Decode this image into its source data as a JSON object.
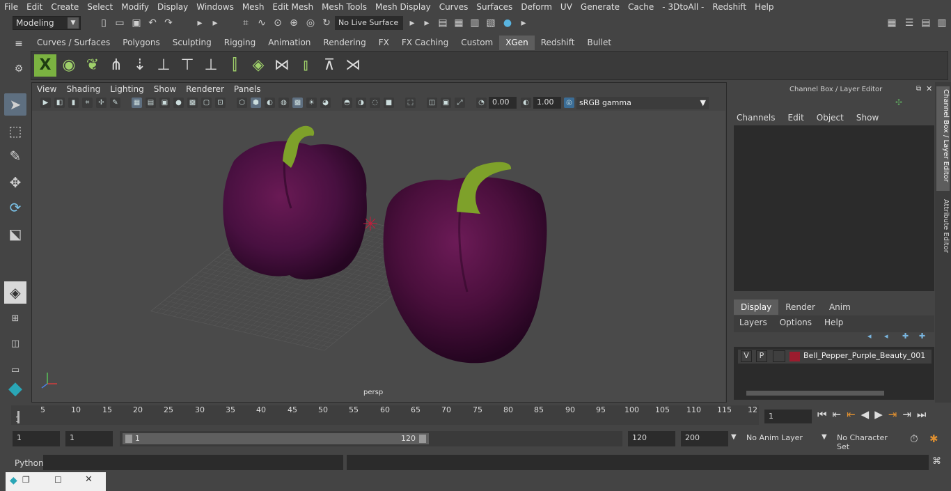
{
  "menubar": {
    "items": [
      "File",
      "Edit",
      "Create",
      "Select",
      "Modify",
      "Display",
      "Windows",
      "Mesh",
      "Edit Mesh",
      "Mesh Tools",
      "Mesh Display",
      "Curves",
      "Surfaces",
      "Deform",
      "UV",
      "Generate",
      "Cache",
      "- 3DtoAll -",
      "Redshift",
      "Help"
    ]
  },
  "status": {
    "mode": "Modeling",
    "live_surface": "No Live Surface"
  },
  "shelf": {
    "tabs": [
      "Curves / Surfaces",
      "Polygons",
      "Sculpting",
      "Rigging",
      "Animation",
      "Rendering",
      "FX",
      "FX Caching",
      "Custom",
      "XGen",
      "Redshift",
      "Bullet"
    ],
    "active_tab": "XGen"
  },
  "viewport": {
    "menus": [
      "View",
      "Shading",
      "Lighting",
      "Show",
      "Renderer",
      "Panels"
    ],
    "exposure": "0.00",
    "gamma_value": "1.00",
    "color_space": "sRGB gamma",
    "camera_label": "persp"
  },
  "channel_box": {
    "title": "Channel Box / Layer Editor",
    "menus": [
      "Channels",
      "Edit",
      "Object",
      "Show"
    ],
    "layer_tabs": [
      "Display",
      "Render",
      "Anim"
    ],
    "active_layer_tab": "Display",
    "layer_menus": [
      "Layers",
      "Options",
      "Help"
    ],
    "layer": {
      "visible": "V",
      "playback": "P",
      "name": "Bell_Pepper_Purple_Beauty_001",
      "color": "#9b1c2e"
    }
  },
  "side_tabs": [
    "Channel Box / Layer Editor",
    "Attribute Editor"
  ],
  "timeline": {
    "ticks": [
      "5",
      "10",
      "15",
      "20",
      "25",
      "30",
      "35",
      "40",
      "45",
      "50",
      "55",
      "60",
      "65",
      "70",
      "75",
      "80",
      "85",
      "90",
      "95",
      "100",
      "105",
      "110",
      "115",
      "12"
    ],
    "start_marker": "1",
    "current_frame": "1"
  },
  "range": {
    "start": "1",
    "anim_start": "1",
    "slider_start": "1",
    "slider_end": "120",
    "end": "120",
    "anim_end": "200",
    "anim_layer": "No Anim Layer",
    "character_set": "No Character Set"
  },
  "command_line": {
    "language": "Python"
  },
  "colors": {
    "pepper": "#4a0f3c",
    "stem": "#7ea12a",
    "accent": "#5e6f80"
  }
}
